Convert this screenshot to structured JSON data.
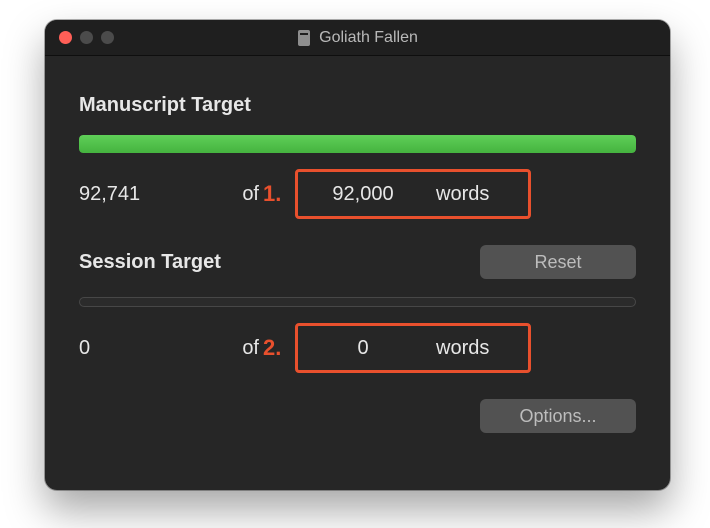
{
  "window": {
    "title": "Goliath Fallen"
  },
  "manuscript": {
    "heading": "Manuscript Target",
    "current": "92,741",
    "of_label": "of",
    "target": "92,000",
    "unit": "words",
    "progress_percent": 100
  },
  "session": {
    "heading": "Session Target",
    "current": "0",
    "of_label": "of",
    "target": "0",
    "unit": "words",
    "reset_label": "Reset"
  },
  "options_label": "Options...",
  "annotations": {
    "one": "1.",
    "two": "2."
  }
}
